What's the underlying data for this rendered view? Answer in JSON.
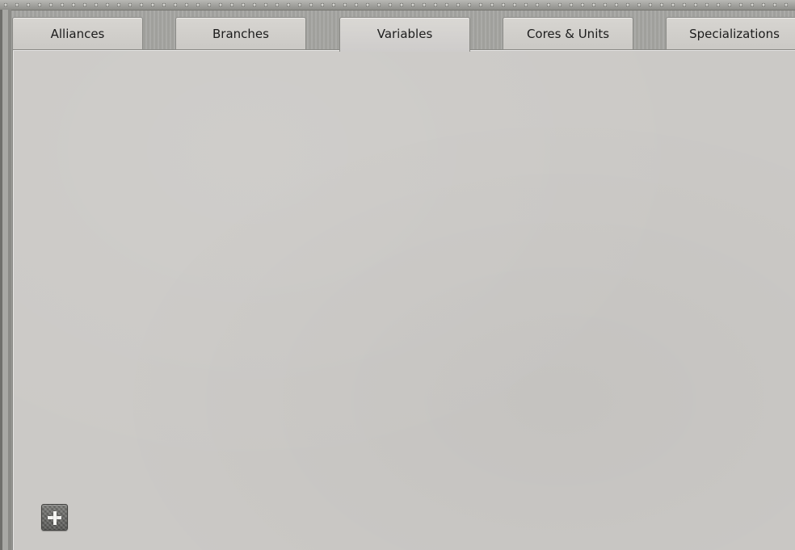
{
  "tabs": [
    {
      "id": "alliances",
      "label": "Alliances",
      "active": false
    },
    {
      "id": "branches",
      "label": "Branches",
      "active": false
    },
    {
      "id": "variables",
      "label": "Variables",
      "active": true
    },
    {
      "id": "cores-units",
      "label": "Cores & Units",
      "active": false
    },
    {
      "id": "specializations",
      "label": "Specializations",
      "active": false
    }
  ],
  "panel": {
    "active_tab": "Variables",
    "items": []
  },
  "add_button": {
    "icon": "plus-icon"
  },
  "colors": {
    "panel_background": "#cbc9c6",
    "tab_background": "#d7d5d1",
    "metal_frame": "#a7a7a3",
    "add_button": "#6a6a68",
    "text": "#1c1c1c"
  }
}
